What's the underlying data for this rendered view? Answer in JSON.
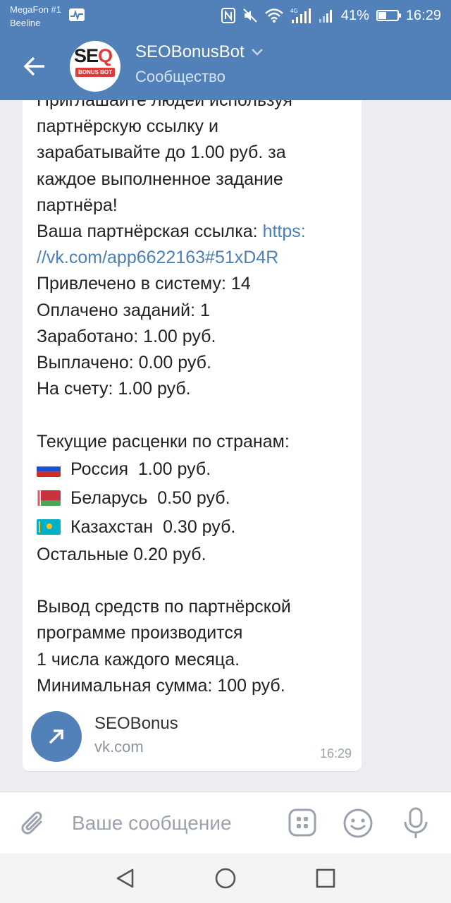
{
  "status_bar": {
    "carrier1": "MegaFon #1",
    "carrier2": "Beeline",
    "signal_label": "4G",
    "battery": "41%",
    "battery_level": 0.41,
    "time": "16:29"
  },
  "header": {
    "bot_name": "SEOBonusBot",
    "subtitle": "Сообщество",
    "avatar_text_seo": "SE",
    "avatar_text_q": "Q",
    "avatar_text_bonus": "BONUS BOT"
  },
  "message": {
    "lines": [
      "Приглашайте людей используя",
      "партнёрскую ссылку и",
      "зарабатывайте до 1.00 руб. за",
      "каждое выполненное задание",
      "партнёра!"
    ],
    "link_prefix": "Ваша партнёрская ссылка: ",
    "link_part1": "https:",
    "link_part2": "//vk.com/app6622163#51xD4R",
    "stats": [
      "Привлечено в систему: 14",
      "Оплачено заданий: 1",
      "Заработано: 1.00 руб.",
      "Выплачено: 0.00 руб.",
      "На счету: 1.00 руб."
    ],
    "rates_title": "Текущие расценки по странам:",
    "rates": [
      {
        "country": "Россия",
        "price": "1.00 руб.",
        "flag": "russia-flag"
      },
      {
        "country": "Беларусь",
        "price": "0.50 руб.",
        "flag": "belarus-flag"
      },
      {
        "country": "Казахстан",
        "price": "0.30 руб.",
        "flag": "kazakhstan-flag"
      }
    ],
    "others": "Остальные 0.20 руб.",
    "payout_lines": [
      "Вывод средств по партнёрской",
      "программе производится",
      "1 числа каждого месяца.",
      "Минимальная сумма: 100 руб."
    ],
    "preview_title": "SEOBonus",
    "preview_domain": "vk.com",
    "time": "16:29"
  },
  "composer": {
    "placeholder": "Ваше сообщение"
  },
  "colors": {
    "header_bg": "#5181b8",
    "link": "#4a7fb8",
    "background": "#ebedf0"
  },
  "icons": [
    "back-arrow-icon",
    "chevron-down-icon",
    "attach-icon",
    "keyboard-bot-icon",
    "emoji-icon",
    "microphone-icon",
    "nav-back-icon",
    "nav-home-icon",
    "nav-recents-icon",
    "external-link-arrow-icon"
  ]
}
